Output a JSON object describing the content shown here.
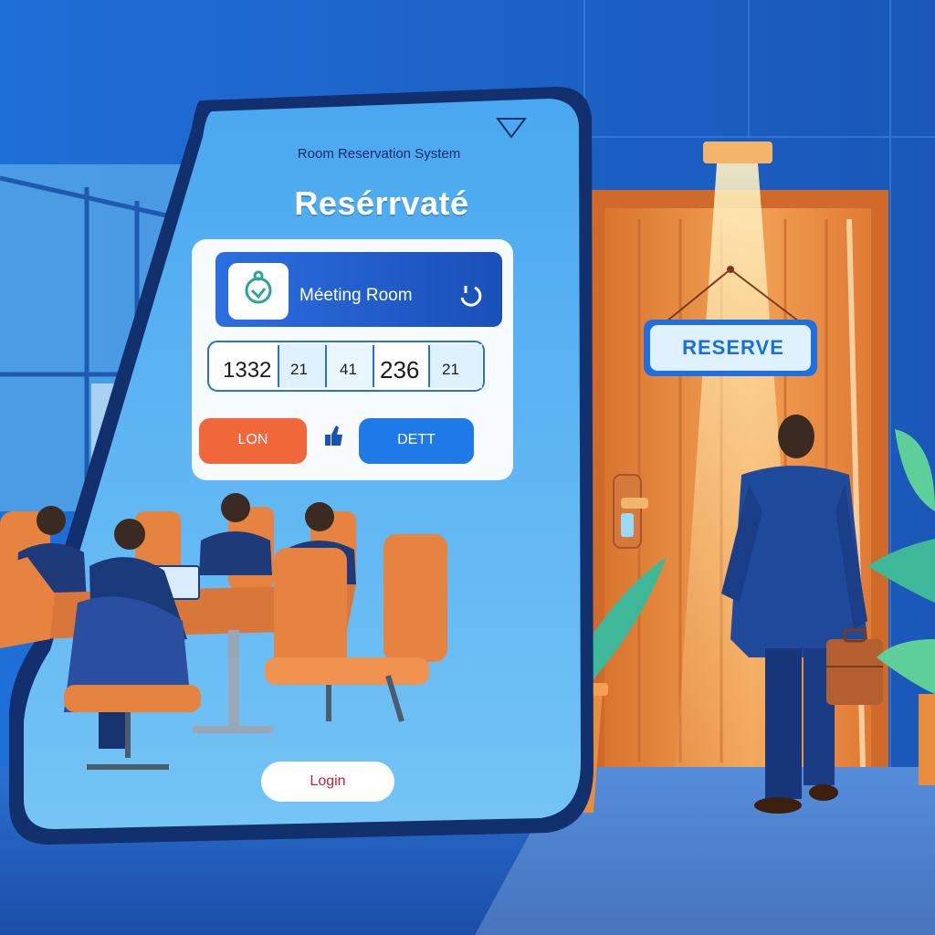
{
  "tablet": {
    "system_title": "Room Reservation System",
    "heading": "Resérrvaté",
    "room": {
      "label": "Méeting Room",
      "icon": "room-icon",
      "status_icon": "clock-icon"
    },
    "time_slots": [
      "1332",
      "21",
      "41",
      "236",
      "21"
    ],
    "buttons": {
      "left_label": "LON",
      "right_label": "DETT",
      "login_label": "Login"
    }
  },
  "door_sign": {
    "label": "RESERVE"
  },
  "colors": {
    "tablet_screen": "#5ab4f2",
    "room_banner": "#1f5fd1",
    "left_button": "#f0673a",
    "right_button": "#1f7ae8",
    "door": "#e8914a",
    "sign": "#dff1ff"
  }
}
